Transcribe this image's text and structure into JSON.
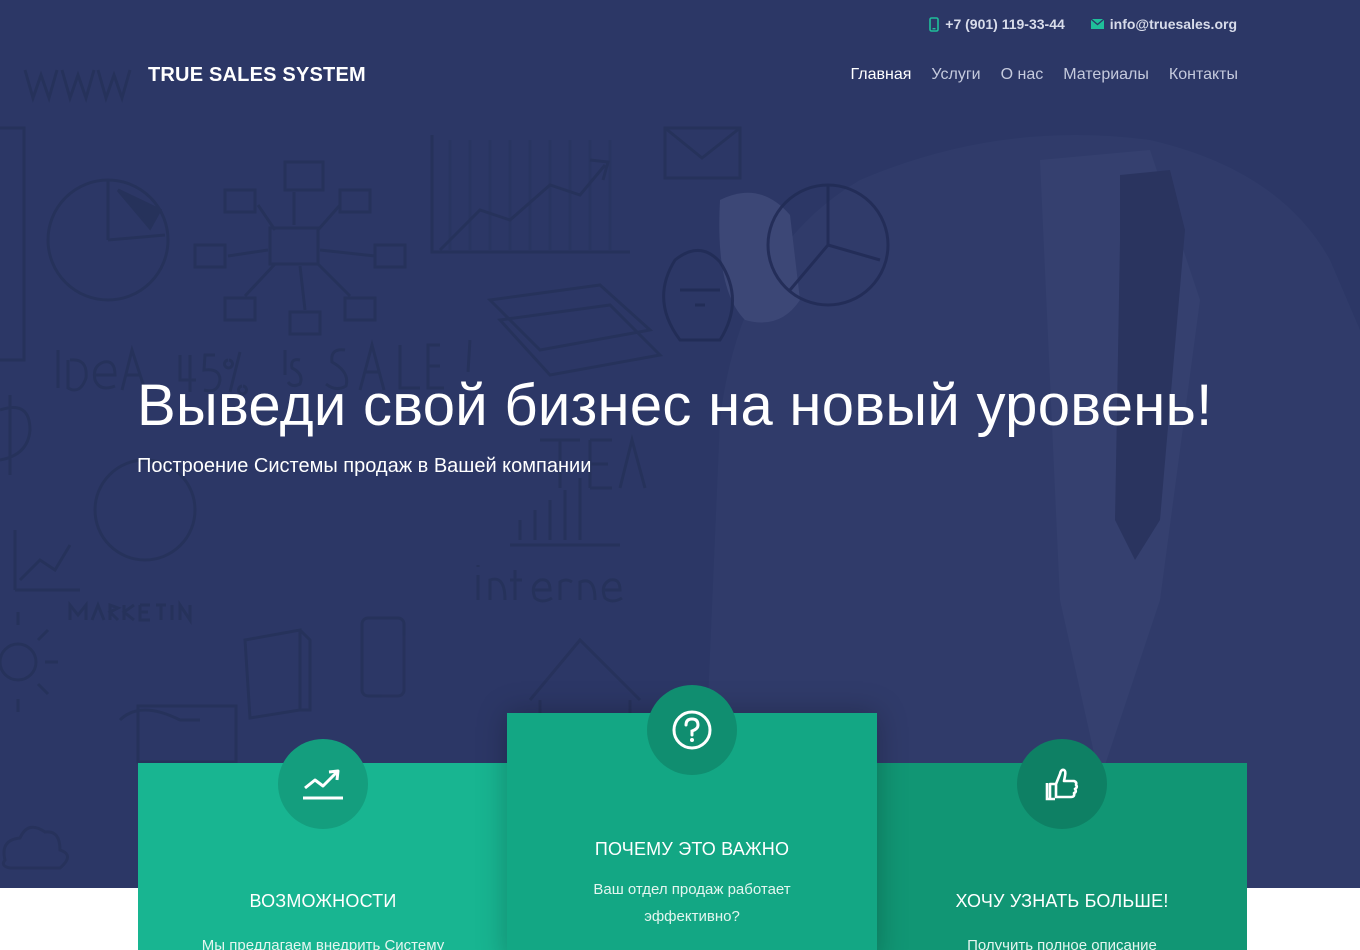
{
  "header": {
    "phone": "+7 (901) 119-33-44",
    "email": "info@truesales.org",
    "brand": "TRUE SALES SYSTEM"
  },
  "nav": {
    "items": [
      {
        "label": "Главная",
        "active": true
      },
      {
        "label": "Услуги",
        "active": false
      },
      {
        "label": "О нас",
        "active": false
      },
      {
        "label": "Материалы",
        "active": false
      },
      {
        "label": "Контакты",
        "active": false
      }
    ]
  },
  "hero": {
    "title": "Выведи свой бизнес на новый уровень!",
    "subtitle": "Построение Системы продаж в Вашей компании",
    "sketch_words": [
      "www",
      "iDeA",
      "45% is SALE!",
      "TEAM",
      "internet",
      "MARKETING"
    ]
  },
  "cards": [
    {
      "title": "ВОЗМОЖНОСТИ",
      "text": "Мы предлагаем внедрить Систему",
      "icon": "trend-up-icon"
    },
    {
      "title": "ПОЧЕМУ ЭТО ВАЖНО",
      "text": "Ваш отдел продаж работает эффективно?",
      "icon": "question-icon"
    },
    {
      "title": "ХОЧУ УЗНАТЬ БОЛЬШЕ!",
      "text": "Получить полное описание системы",
      "icon": "thumbs-up-icon"
    }
  ],
  "colors": {
    "hero_overlay": "#2c3866",
    "accent_green": "#18b591",
    "topbar_icon": "#1fbf9a"
  }
}
